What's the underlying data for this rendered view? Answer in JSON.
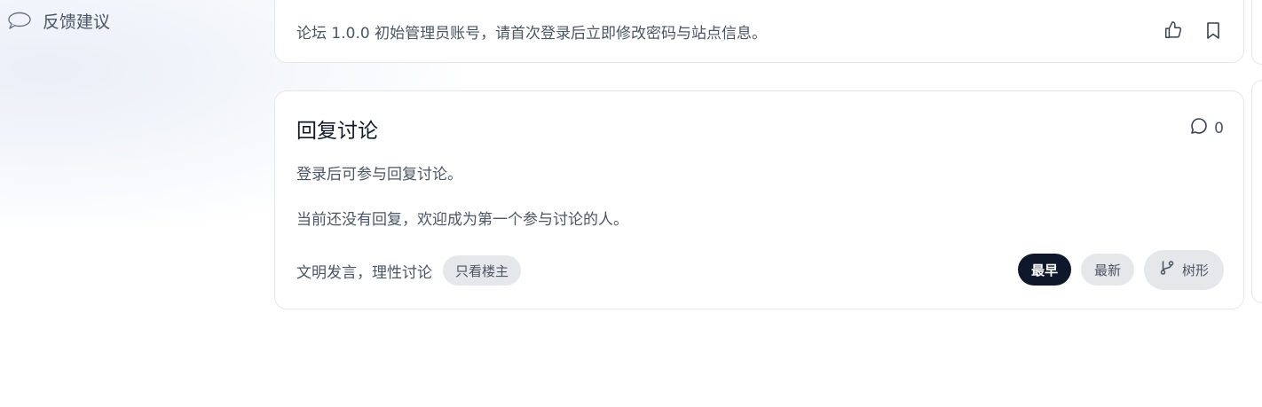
{
  "sidebar": {
    "items": [
      {
        "label": "反馈建议",
        "icon": "speech-bubble-icon"
      }
    ]
  },
  "top_card": {
    "text": "论坛 1.0.0 初始管理员账号，请首次登录后立即修改密码与站点信息。",
    "actions": [
      {
        "icon": "thumbs-up-icon"
      },
      {
        "icon": "bookmark-icon"
      }
    ]
  },
  "reply_section": {
    "title": "回复讨论",
    "comment_count": "0",
    "login_hint": "登录后可参与回复讨论。",
    "empty_hint": "当前还没有回复，欢迎成为第一个参与讨论的人。",
    "civility_note": "文明发言，理性讨论",
    "op_only_label": "只看楼主",
    "sort": {
      "earliest": "最早",
      "latest": "最新",
      "tree": "树形",
      "active": "earliest"
    }
  },
  "colors": {
    "active_sort_bg": "#0f172a",
    "pill_bg": "#e5e7eb",
    "text_muted": "#4b5563",
    "border": "#e5e7eb"
  }
}
